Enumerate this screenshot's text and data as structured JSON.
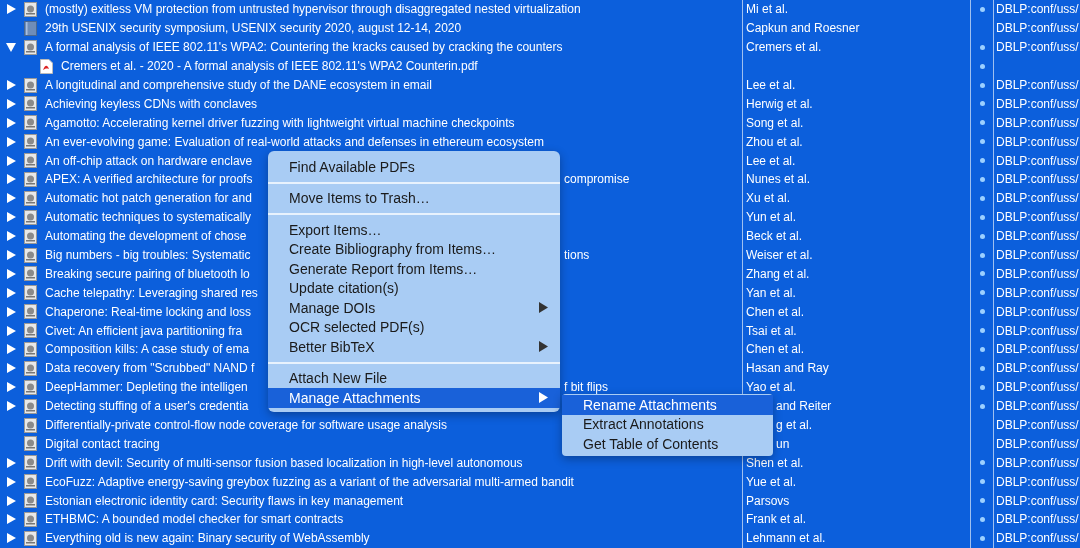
{
  "items": [
    {
      "kind": "article",
      "has_children": true,
      "expanded": false,
      "selected": true,
      "title": "(mostly) exitless VM protection from untrusted hypervisor through disaggregated nested virtualization",
      "creator": "Mi et al.",
      "dot": true,
      "extra": "DBLP:conf/uss/"
    },
    {
      "kind": "book",
      "has_children": false,
      "selected": true,
      "title": "29th USENIX security symposium, USENIX security 2020, august 12-14, 2020",
      "creator": "Capkun and Roesner",
      "dot": false,
      "extra": "DBLP:conf/uss/"
    },
    {
      "kind": "article",
      "has_children": true,
      "expanded": true,
      "selected": true,
      "title": "A formal analysis of IEEE 802.11's WPA2: Countering the kracks caused by cracking the counters",
      "creator": "Cremers et al.",
      "dot": true,
      "extra": "DBLP:conf/uss/",
      "children": [
        {
          "kind": "pdf",
          "has_children": false,
          "selected": true,
          "title": "Cremers et al. - 2020 - A formal analysis of IEEE 802.11's WPA2 Counterin.pdf",
          "dot": true
        }
      ]
    },
    {
      "kind": "article",
      "has_children": true,
      "expanded": false,
      "selected": true,
      "title": "A longitudinal and comprehensive study of the DANE ecosystem in email",
      "creator": "Lee et al.",
      "dot": true,
      "extra": "DBLP:conf/uss/"
    },
    {
      "kind": "article",
      "has_children": true,
      "expanded": false,
      "selected": true,
      "title": "Achieving keyless CDNs with conclaves",
      "creator": "Herwig et al.",
      "dot": true,
      "extra": "DBLP:conf/uss/"
    },
    {
      "kind": "article",
      "has_children": true,
      "expanded": false,
      "selected": true,
      "title": "Agamotto: Accelerating kernel driver fuzzing with lightweight virtual machine checkpoints",
      "creator": "Song et al.",
      "dot": true,
      "extra": "DBLP:conf/uss/"
    },
    {
      "kind": "article",
      "has_children": true,
      "expanded": false,
      "selected": true,
      "title": "An ever-evolving game: Evaluation of real-world attacks and defenses in ethereum ecosystem",
      "creator": "Zhou et al.",
      "dot": true,
      "extra": "DBLP:conf/uss/"
    },
    {
      "kind": "article",
      "has_children": true,
      "expanded": false,
      "selected": true,
      "title": "An off-chip attack on hardware enclave",
      "creator": "Lee et al.",
      "dot": true,
      "extra": "DBLP:conf/uss/"
    },
    {
      "kind": "article",
      "has_children": true,
      "expanded": false,
      "selected": true,
      "title": "APEX: A verified architecture for proofs",
      "title_tail": "compromise",
      "creator": "Nunes et al.",
      "dot": true,
      "extra": "DBLP:conf/uss/"
    },
    {
      "kind": "article",
      "has_children": true,
      "expanded": false,
      "selected": true,
      "title": "Automatic hot patch generation for and",
      "creator": "Xu et al.",
      "dot": true,
      "extra": "DBLP:conf/uss/"
    },
    {
      "kind": "article",
      "has_children": true,
      "expanded": false,
      "selected": true,
      "title": "Automatic techniques to systematically",
      "creator": "Yun et al.",
      "dot": true,
      "extra": "DBLP:conf/uss/"
    },
    {
      "kind": "article",
      "has_children": true,
      "expanded": false,
      "selected": true,
      "title": "Automating the development of chose",
      "creator": "Beck et al.",
      "dot": true,
      "extra": "DBLP:conf/uss/"
    },
    {
      "kind": "article",
      "has_children": true,
      "expanded": false,
      "selected": true,
      "title": "Big numbers - big troubles: Systematic",
      "title_tail": "tions",
      "creator": "Weiser et al.",
      "dot": true,
      "extra": "DBLP:conf/uss/"
    },
    {
      "kind": "article",
      "has_children": true,
      "expanded": false,
      "selected": true,
      "title": "Breaking secure pairing of bluetooth lo",
      "creator": "Zhang et al.",
      "dot": true,
      "extra": "DBLP:conf/uss/"
    },
    {
      "kind": "article",
      "has_children": true,
      "expanded": false,
      "selected": true,
      "title": "Cache telepathy: Leveraging shared res",
      "creator": "Yan et al.",
      "dot": true,
      "extra": "DBLP:conf/uss/"
    },
    {
      "kind": "article",
      "has_children": true,
      "expanded": false,
      "selected": true,
      "title": "Chaperone: Real-time locking and loss",
      "creator": "Chen et al.",
      "dot": true,
      "extra": "DBLP:conf/uss/"
    },
    {
      "kind": "article",
      "has_children": true,
      "expanded": false,
      "selected": true,
      "title": "Civet: An efficient java partitioning fra",
      "creator": "Tsai et al.",
      "dot": true,
      "extra": "DBLP:conf/uss/"
    },
    {
      "kind": "article",
      "has_children": true,
      "expanded": false,
      "selected": true,
      "title": "Composition kills: A case study of ema",
      "creator": "Chen et al.",
      "dot": true,
      "extra": "DBLP:conf/uss/"
    },
    {
      "kind": "article",
      "has_children": true,
      "expanded": false,
      "selected": true,
      "title": "Data recovery from \"Scrubbed\" NAND f",
      "creator": "Hasan and Ray",
      "dot": true,
      "extra": "DBLP:conf/uss/"
    },
    {
      "kind": "article",
      "has_children": true,
      "expanded": false,
      "selected": true,
      "title": "DeepHammer: Depleting the intelligen",
      "title_tail": "f bit flips",
      "creator": "Yao et al.",
      "dot": true,
      "extra": "DBLP:conf/uss/"
    },
    {
      "kind": "article",
      "has_children": true,
      "expanded": false,
      "selected": true,
      "title": "Detecting stuffing of a user's credentia",
      "creator": "and Reiter",
      "creator_covered": true,
      "dot": true,
      "extra": "DBLP:conf/uss/"
    },
    {
      "kind": "article",
      "has_children": false,
      "selected": true,
      "title": "Differentially-private control-flow node coverage for software usage analysis",
      "creator": "g et al.",
      "creator_covered": true,
      "dot": false,
      "extra": "DBLP:conf/uss/"
    },
    {
      "kind": "article",
      "has_children": false,
      "selected": true,
      "title": "Digital contact tracing",
      "creator": "un",
      "creator_covered": true,
      "dot": false,
      "extra": "DBLP:conf/uss/"
    },
    {
      "kind": "article",
      "has_children": true,
      "expanded": false,
      "selected": true,
      "title": "Drift with devil: Security of multi-sensor fusion based localization in high-level autonomous",
      "creator": "Shen et al.",
      "dot": true,
      "extra": "DBLP:conf/uss/"
    },
    {
      "kind": "article",
      "has_children": true,
      "expanded": false,
      "selected": true,
      "title": "EcoFuzz: Adaptive energy-saving greybox fuzzing as a variant of the adversarial multi-armed bandit",
      "creator": "Yue et al.",
      "dot": true,
      "extra": "DBLP:conf/uss/"
    },
    {
      "kind": "article",
      "has_children": true,
      "expanded": false,
      "selected": true,
      "title": "Estonian electronic identity card: Security flaws in key management",
      "creator": "Parsovs",
      "dot": true,
      "extra": "DBLP:conf/uss/"
    },
    {
      "kind": "article",
      "has_children": true,
      "expanded": false,
      "selected": true,
      "title": "ETHBMC: A bounded model checker for smart contracts",
      "creator": "Frank et al.",
      "dot": true,
      "extra": "DBLP:conf/uss/"
    },
    {
      "kind": "article",
      "has_children": true,
      "expanded": false,
      "selected": true,
      "title": "Everything old is new again: Binary security of WebAssembly",
      "creator": "Lehmann et al.",
      "dot": true,
      "extra": "DBLP:conf/uss/"
    }
  ],
  "context_menu": {
    "items": [
      {
        "kind": "item",
        "label": "Find Available PDFs",
        "submenu": false,
        "selected": false
      },
      {
        "kind": "separator"
      },
      {
        "kind": "item",
        "label": "Move Items to Trash…",
        "submenu": false,
        "selected": false
      },
      {
        "kind": "separator"
      },
      {
        "kind": "item",
        "label": "Export Items…",
        "submenu": false,
        "selected": false
      },
      {
        "kind": "item",
        "label": "Create Bibliography from Items…",
        "submenu": false,
        "selected": false
      },
      {
        "kind": "item",
        "label": "Generate Report from Items…",
        "submenu": false,
        "selected": false
      },
      {
        "kind": "item",
        "label": "Update citation(s)",
        "submenu": false,
        "selected": false
      },
      {
        "kind": "item",
        "label": "Manage DOIs",
        "submenu": true,
        "selected": false
      },
      {
        "kind": "item",
        "label": "OCR selected PDF(s)",
        "submenu": false,
        "selected": false
      },
      {
        "kind": "item",
        "label": "Better BibTeX",
        "submenu": true,
        "selected": false
      },
      {
        "kind": "separator"
      },
      {
        "kind": "item",
        "label": "Attach New File",
        "submenu": false,
        "selected": false
      },
      {
        "kind": "item",
        "label": "Manage Attachments",
        "submenu": true,
        "selected": true
      }
    ],
    "submenu": [
      {
        "label": "Rename Attachments",
        "selected": true
      },
      {
        "label": "Extract Annotations",
        "selected": false
      },
      {
        "label": "Get Table of Contents",
        "selected": false
      }
    ]
  }
}
